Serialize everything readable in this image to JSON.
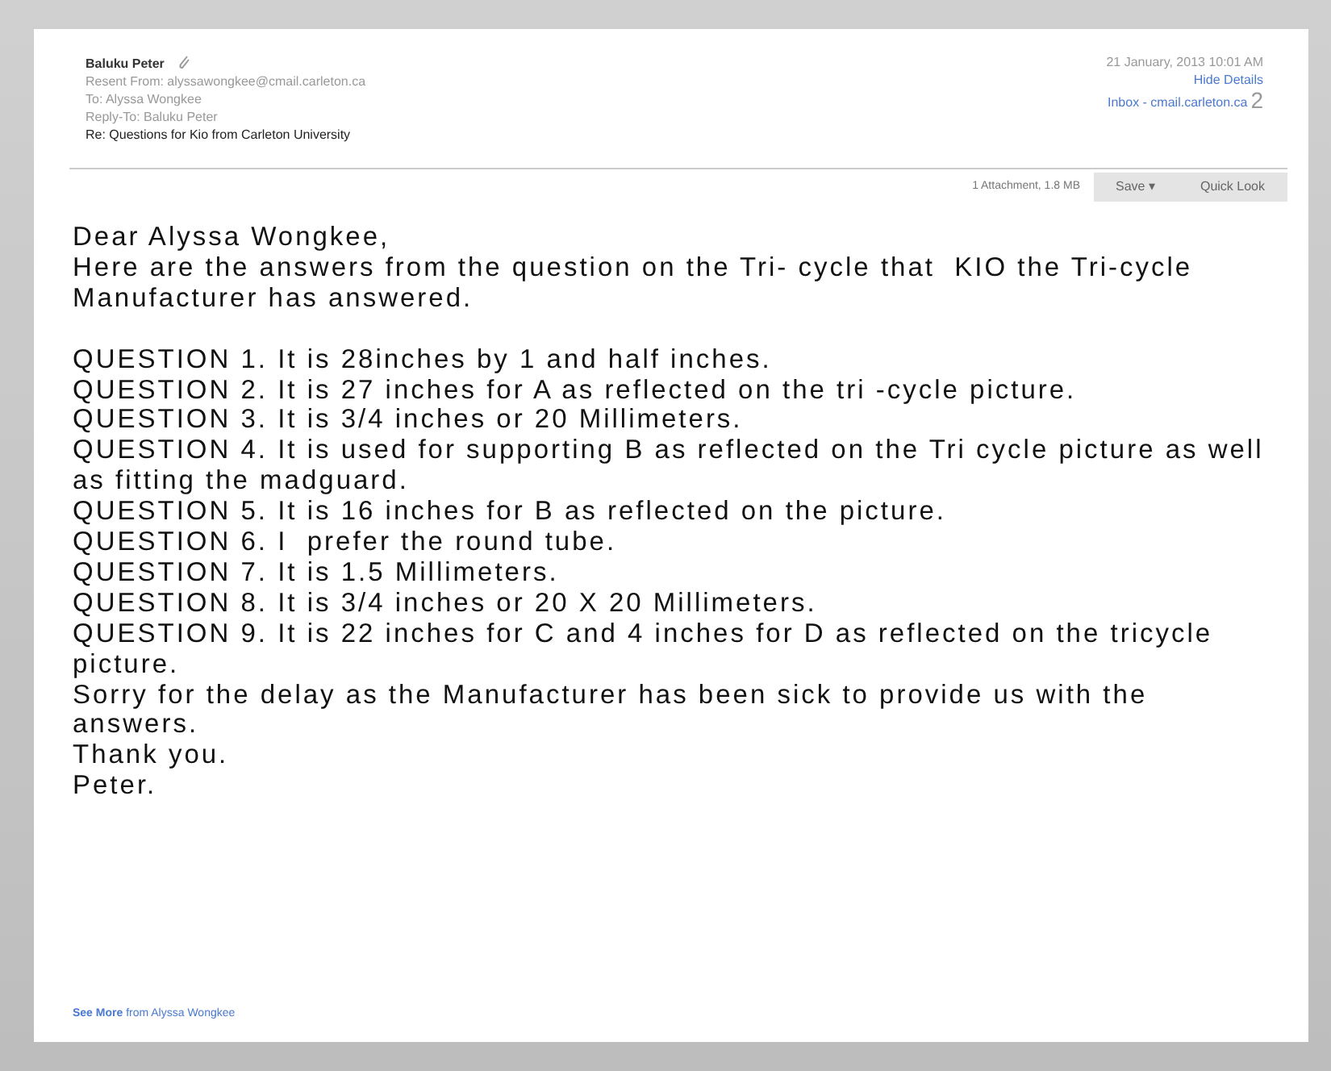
{
  "header": {
    "sender": "Baluku Peter",
    "resent_from": "Resent From:  alyssawongkee@cmail.carleton.ca",
    "to": "To:  Alyssa Wongkee",
    "reply_to": "Reply-To:  Baluku Peter",
    "subject": "Re: Questions for Kio from Carleton University",
    "date": "21 January, 2013 10:01 AM",
    "hide_details": "Hide Details",
    "mailbox": "Inbox - cmail.carleton.ca",
    "mailbox_mark": "2"
  },
  "attachment_bar": {
    "summary": "1 Attachment, 1.8 MB",
    "buttons": [
      "Save ▾",
      "Quick Look"
    ]
  },
  "body": [
    [
      "Dear Alyssa Wongkee,",
      "Here are the answers from the question on the Tri- cycle that  KIO the Tri-cycle Manufacturer has answered."
    ],
    [
      "QUESTION 1. It is 28inches by 1 and half inches.",
      "QUESTION 2. It is 27 inches for A as reflected on the tri -cycle picture.",
      "QUESTION 3. It is 3/4 inches or 20 Millimeters.",
      "QUESTION 4. It is used for supporting B as reflected on the Tri cycle picture as well as fitting the madguard.",
      "QUESTION 5. It is 16 inches for B as reflected on the picture.",
      "QUESTION 6. I  prefer the round tube.",
      "QUESTION 7. It is 1.5 Millimeters.",
      "QUESTION 8. It is 3/4 inches or 20 X 20 Millimeters.",
      "QUESTION 9. It is 22 inches for C and 4 inches for D as reflected on the tricycle picture.",
      "Sorry for the delay as the Manufacturer has been sick to provide us with the answers.",
      "Thank you.",
      "Peter."
    ]
  ],
  "see_more": "**See More** from Alyssa Wongkee"
}
